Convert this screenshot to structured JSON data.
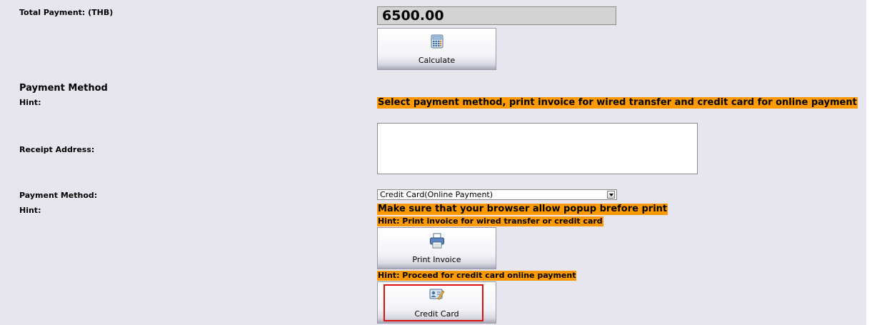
{
  "total": {
    "label": "Total Payment: (THB)",
    "value": "6500.00"
  },
  "calculate": {
    "label": "Calculate",
    "icon": "calculator-icon"
  },
  "section": {
    "title": "Payment Method",
    "hint_label": "Hint:",
    "hint_text": "Select payment method, print invoice for wired transfer and credit card for online payment"
  },
  "receipt": {
    "label": "Receipt Address:",
    "value": ""
  },
  "payment": {
    "label": "Payment Method:",
    "selected": "Credit Card(Online Payment)",
    "hint_label": "Hint:",
    "popup_hint": "Make sure that your browser allow popup brefore print",
    "print_hint": "Hint: Print invoice for wired transfer or credit card",
    "print_label": "Print Invoice",
    "proceed_hint": "Hint: Proceed for credit card online payment",
    "card_label": "Credit Card"
  },
  "colors": {
    "panel_bg": "#e7e6ee",
    "hint_bg": "#ff9900",
    "highlight_border": "#dd1111"
  }
}
